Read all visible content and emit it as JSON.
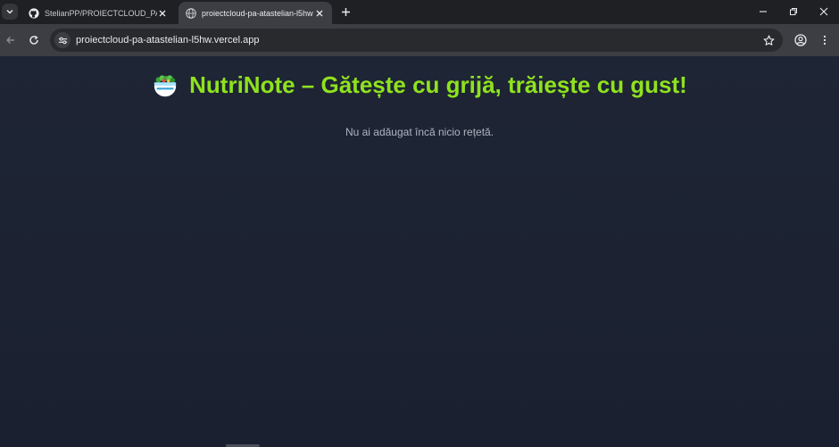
{
  "browser": {
    "tabs": [
      {
        "label": "StelianPP/PROIECTCLOUD_PA-A",
        "icon": "github-icon",
        "active": false
      },
      {
        "label": "proiectcloud-pa-atastelian-l5hw",
        "icon": "globe-icon",
        "active": true
      }
    ],
    "url": "proiectcloud-pa-atastelian-l5hw.vercel.app"
  },
  "page": {
    "title": "NutriNote – Gătește cu grijă, trăiește cu gust!",
    "title_icon": "salad-bowl-icon",
    "empty_message": "Nu ai adăugat încă nicio rețetă."
  },
  "colors": {
    "accent": "#8fe21e",
    "background": "#1c2230",
    "muted_text": "#aeb4bf"
  }
}
